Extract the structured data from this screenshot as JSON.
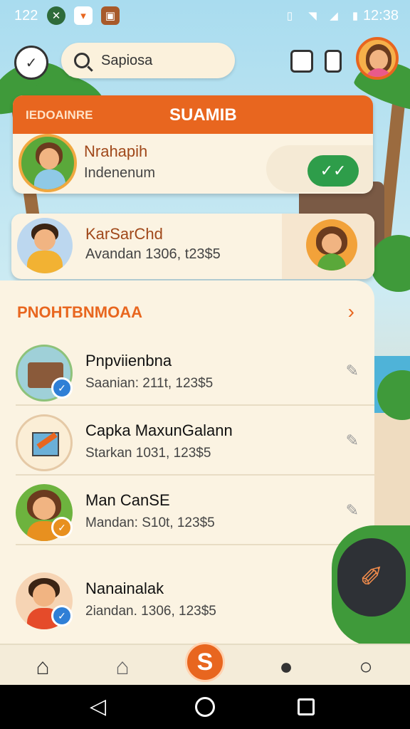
{
  "status_bar": {
    "left_text": "122",
    "clock": "12:38"
  },
  "search": {
    "value": "Sapiosa"
  },
  "featured_card": {
    "header_left": "IEDOAINRE",
    "header_center": "SUAMIB",
    "name": "Nrahapih",
    "subtitle": "Indenenum",
    "chat_icon": "chat-icon"
  },
  "second_card": {
    "name": "KarSarChd",
    "subtitle": "Avandan 1306, t23$5"
  },
  "section": {
    "title": "PNOHTBNMOAA",
    "chevron": "›"
  },
  "list": [
    {
      "name": "Pnpviienbna",
      "subtitle": "Saanian: 211t, 123$5",
      "badge_color": "#2f7fd6"
    },
    {
      "name": "Capka MaxunGalann",
      "subtitle": "Starkan 1031, 123$5",
      "badge_color": ""
    },
    {
      "name": "Man CanSE",
      "subtitle": "Mandan: S10t, 123$5",
      "badge_color": "#e8901f"
    },
    {
      "name": "Nanainalak",
      "subtitle": "2iandan. 1306, 123$5",
      "badge_color": "#2f7fd6"
    }
  ],
  "bottom_nav": {
    "center_label": "S"
  },
  "colors": {
    "accent": "#e8661f",
    "card": "#fbf3e2",
    "green": "#2e9d4a"
  }
}
